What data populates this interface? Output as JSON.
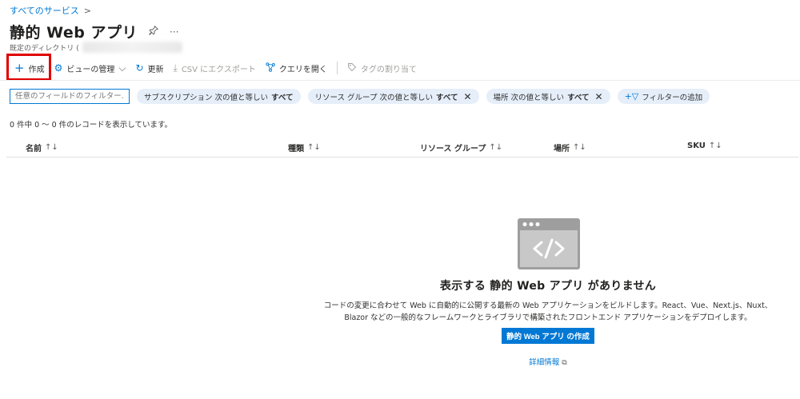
{
  "breadcrumb": {
    "item": "すべてのサービス",
    "separator": ">"
  },
  "header": {
    "title": "静的 Web アプリ",
    "subtitle_prefix": "既定のディレクトリ (",
    "pin_icon": "pin-icon",
    "more_icon": "ellipsis-icon"
  },
  "toolbar": {
    "create": "作成",
    "manage_view": "ビューの管理",
    "refresh": "更新",
    "export_csv": "CSV にエクスポート",
    "open_query": "クエリを開く",
    "assign_tags": "タグの割り当て"
  },
  "filters": {
    "search_placeholder": "任意のフィールドのフィルター...",
    "subscription": {
      "label": "サブスクリプション 次の値と等しい",
      "value": "すべて"
    },
    "resource_group": {
      "label": "リソース グループ 次の値と等しい",
      "value": "すべて"
    },
    "location": {
      "label": "場所 次の値と等しい",
      "value": "すべて"
    },
    "add_filter": "フィルターの追加"
  },
  "record_count": "0 件中 0 〜 0 件のレコードを表示しています。",
  "table": {
    "columns": [
      "名前",
      "種類",
      "リソース グループ",
      "場所",
      "SKU"
    ],
    "sort_glyph": "↑↓"
  },
  "empty_state": {
    "title": "表示する 静的 Web アプリ がありません",
    "description_line1": "コードの変更に合わせて Web に自動的に公開する最新の Web アプリケーションをビルドします。React、Vue、Next.js、Nuxt、",
    "description_line2": "Blazor などの一般的なフレームワークとライブラリで構築されたフロントエンド アプリケーションをデプロイします。",
    "create_button": "静的 Web アプリ の作成",
    "more_info": "詳細情報"
  },
  "colors": {
    "accent": "#0078d4",
    "highlight": "#e00000",
    "pill_bg": "#e5eef9",
    "illustration": "#9e9e9e"
  }
}
